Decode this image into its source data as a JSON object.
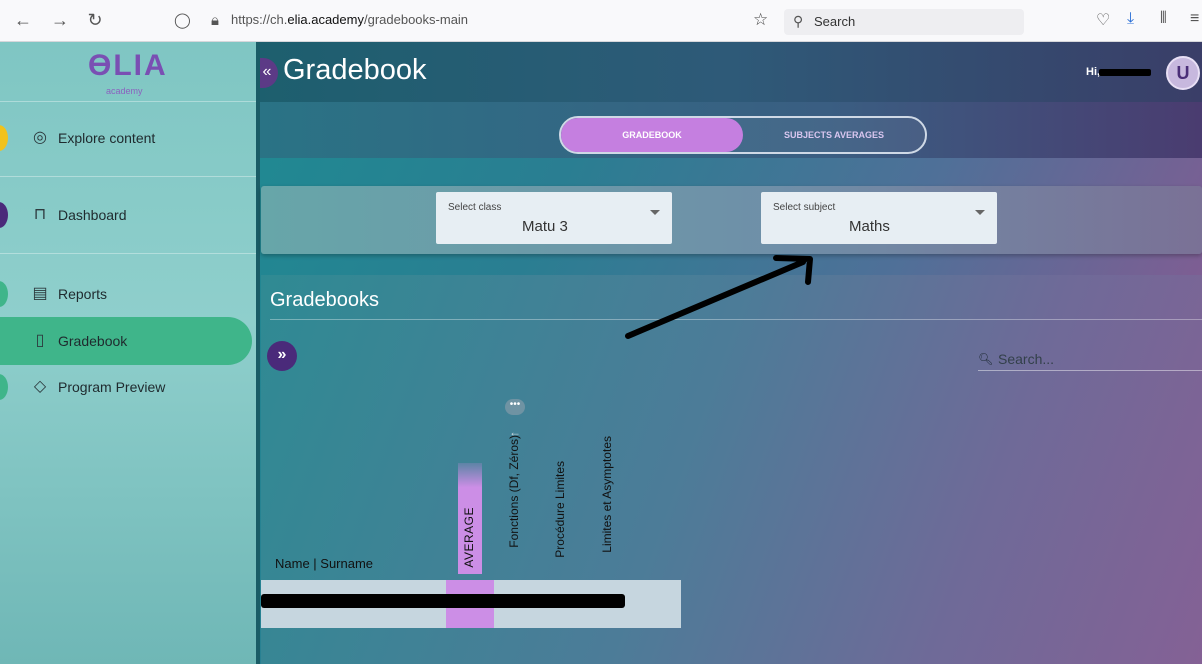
{
  "browser": {
    "url_prefix": "https://ch.",
    "url_domain": "elia.academy",
    "url_path": "/gradebooks-main",
    "search_placeholder": "Search"
  },
  "logo": {
    "mark": "ϴLIA",
    "sub": "academy"
  },
  "sidebar": {
    "items": [
      {
        "label": "Explore content",
        "icon": "planet-icon"
      },
      {
        "label": "Dashboard",
        "icon": "easel-icon"
      },
      {
        "label": "Reports",
        "icon": "report-icon"
      },
      {
        "label": "Gradebook",
        "icon": "gradebook-icon",
        "active": true
      },
      {
        "label": "Program Preview",
        "icon": "graduation-cap-icon"
      }
    ]
  },
  "header": {
    "title": "Gradebook",
    "greeting": "Hi,",
    "avatar_letter": "U"
  },
  "tabs": {
    "active": "GRADEBOOK",
    "inactive": "SUBJECTS AVERAGES"
  },
  "filters": {
    "class_caption": "Select class",
    "class_value": "Matu 3",
    "subject_caption": "Select subject",
    "subject_value": "Maths"
  },
  "gradebook": {
    "title": "Gradebooks",
    "search_placeholder": "Search...",
    "more_label": "•••",
    "name_header": "Name | Surname",
    "average_header": "AVERAGE",
    "columns": [
      "Fonctions (Df, Zéros)",
      "Procédure Limites",
      "Limites et Asymptotes"
    ]
  },
  "colors": {
    "accent_purple": "#c57fe0",
    "active_green": "#3fb58a",
    "dark_purple": "#4a2a7a"
  }
}
